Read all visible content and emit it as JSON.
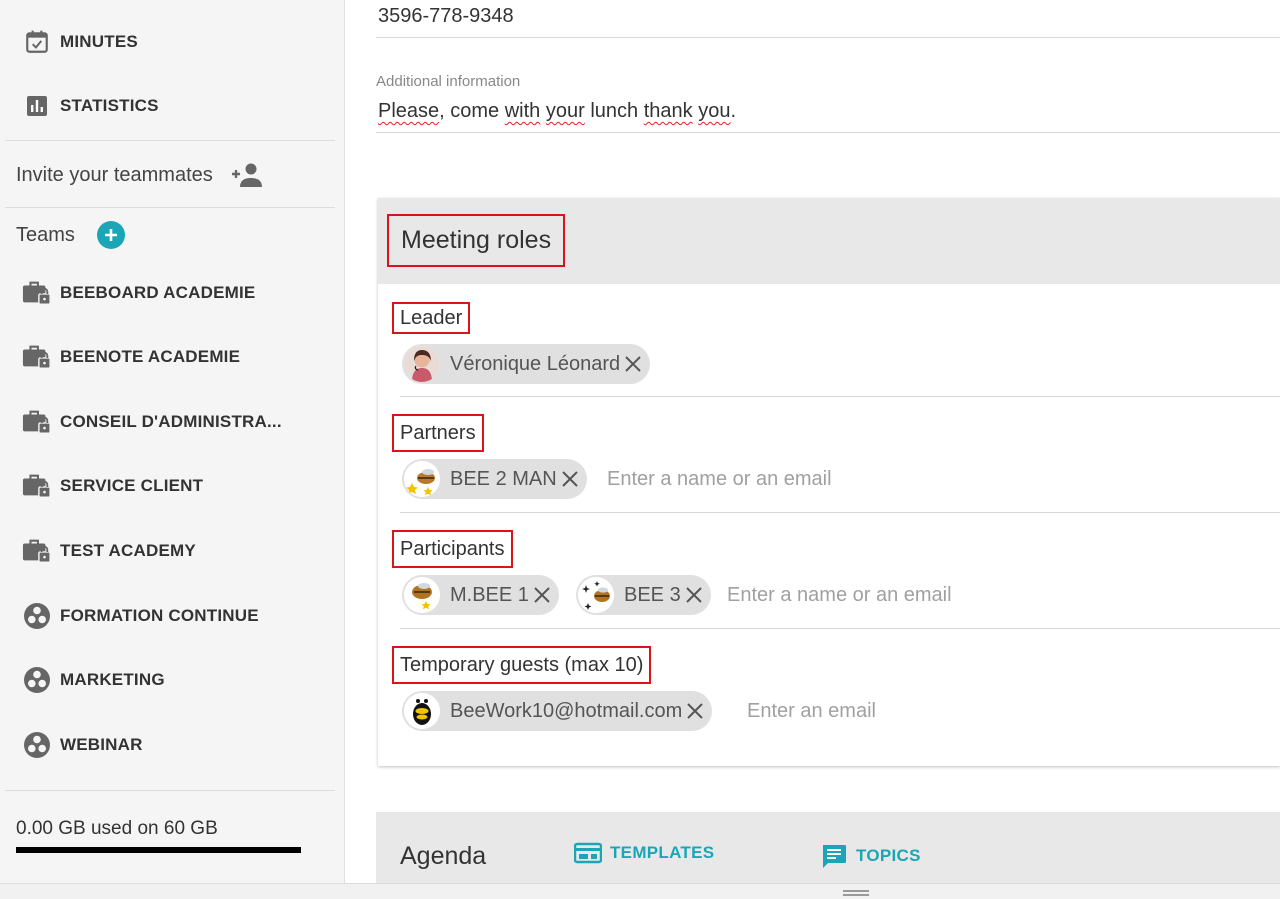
{
  "sidebar": {
    "nav": [
      {
        "label": "MINUTES",
        "icon": "calendar-check-icon"
      },
      {
        "label": "STATISTICS",
        "icon": "bar-chart-icon"
      }
    ],
    "invite_label": "Invite your teammates",
    "teams_label": "Teams",
    "teams": [
      {
        "label": "BEEBOARD ACADEMIE",
        "icon": "locked-briefcase-icon"
      },
      {
        "label": "BEENOTE ACADEMIE",
        "icon": "locked-briefcase-icon"
      },
      {
        "label": "CONSEIL D'ADMINISTRA...",
        "icon": "locked-briefcase-icon"
      },
      {
        "label": "SERVICE CLIENT",
        "icon": "locked-briefcase-icon"
      },
      {
        "label": "TEST ACADEMY",
        "icon": "locked-briefcase-icon"
      },
      {
        "label": "FORMATION CONTINUE",
        "icon": "workspaces-icon"
      },
      {
        "label": "MARKETING",
        "icon": "workspaces-icon"
      },
      {
        "label": "WEBINAR",
        "icon": "workspaces-icon"
      }
    ],
    "storage_text": "0.00 GB used on 60 GB"
  },
  "main": {
    "phone_value": "3596-778-9348",
    "additional_info_label": "Additional information",
    "additional_info_words": [
      "Please",
      ", come ",
      "with",
      " ",
      "your",
      " lunch ",
      "thank",
      " ",
      "you",
      "."
    ],
    "meeting_roles_title": "Meeting roles",
    "roles": {
      "leader": {
        "label": "Leader",
        "chips": [
          "Véronique Léonard"
        ]
      },
      "partners": {
        "label": "Partners",
        "chips": [
          "BEE 2 MAN"
        ],
        "placeholder": "Enter a name or an email"
      },
      "participants": {
        "label": "Participants",
        "chips": [
          "M.BEE 1",
          "BEE 3"
        ],
        "placeholder": "Enter a name or an email"
      },
      "guests": {
        "label": "Temporary guests (max 10)",
        "chips": [
          "BeeWork10@hotmail.com"
        ],
        "placeholder": "Enter an email"
      }
    },
    "agenda": {
      "title": "Agenda",
      "templates_label": "TEMPLATES",
      "topics_label": "TOPICS"
    }
  },
  "colors": {
    "accent": "#1aa6b7",
    "highlight_box": "#d9141b",
    "sidebar_bg": "#f5f5f5",
    "section_header_bg": "#e8e8e8"
  }
}
